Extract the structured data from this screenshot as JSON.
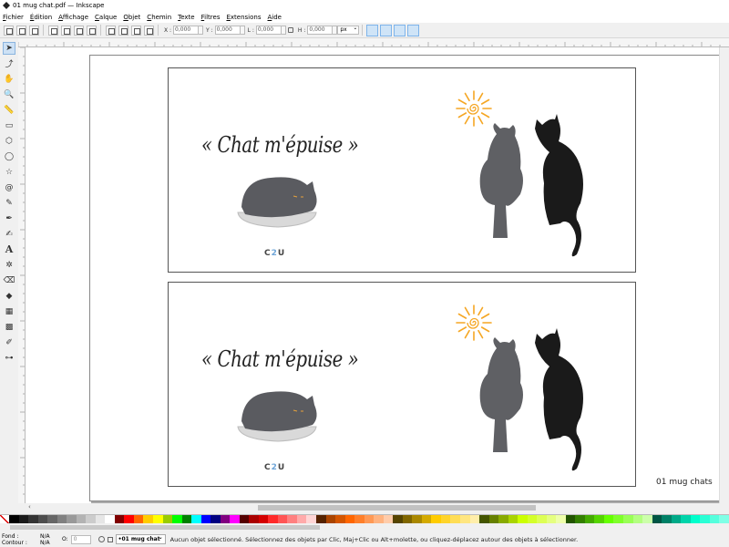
{
  "window": {
    "title": "01 mug chat.pdf — Inkscape"
  },
  "menu": [
    "Fichier",
    "Édition",
    "Affichage",
    "Calque",
    "Objet",
    "Chemin",
    "Texte",
    "Filtres",
    "Extensions",
    "Aide"
  ],
  "toolbar": {
    "x": {
      "label": "X :",
      "value": "0,000"
    },
    "y": {
      "label": "Y :",
      "value": "0,000"
    },
    "w": {
      "label": "L :",
      "value": "0,000"
    },
    "h": {
      "label": "H :",
      "value": "0,000"
    },
    "unit": "px"
  },
  "tools": [
    {
      "name": "selector-tool",
      "glyph": "➤"
    },
    {
      "name": "node-tool",
      "glyph": "⤴"
    },
    {
      "name": "tweak-tool",
      "glyph": "✋"
    },
    {
      "name": "zoom-tool",
      "glyph": "🔍"
    },
    {
      "name": "measure-tool",
      "glyph": "📏"
    },
    {
      "name": "rect-tool",
      "glyph": "▭"
    },
    {
      "name": "3dbox-tool",
      "glyph": "⬡"
    },
    {
      "name": "ellipse-tool",
      "glyph": "◯"
    },
    {
      "name": "star-tool",
      "glyph": "☆"
    },
    {
      "name": "spiral-tool",
      "glyph": "@"
    },
    {
      "name": "pencil-tool",
      "glyph": "✎"
    },
    {
      "name": "pen-tool",
      "glyph": "✒"
    },
    {
      "name": "calligraphy-tool",
      "glyph": "✍"
    },
    {
      "name": "text-tool",
      "glyph": "A"
    },
    {
      "name": "spray-tool",
      "glyph": "✲"
    },
    {
      "name": "eraser-tool",
      "glyph": "⌫"
    },
    {
      "name": "bucket-tool",
      "glyph": "◆"
    },
    {
      "name": "gradient-tool",
      "glyph": "▦"
    },
    {
      "name": "mesh-tool",
      "glyph": "▩"
    },
    {
      "name": "dropper-tool",
      "glyph": "✐"
    },
    {
      "name": "connector-tool",
      "glyph": "⊶"
    }
  ],
  "canvas": {
    "slogan": "« Chat m'épuise »",
    "logo_a": "C",
    "logo_b": "2",
    "logo_c": "U",
    "caption": "01 mug chats"
  },
  "colors": {
    "sun": "#f5a623",
    "grey_cat": "#5f6064",
    "black_cat": "#1a1a1a",
    "bowl": "#d9d9d9",
    "sleeping_cat": "#5a5b60"
  },
  "palette": [
    "#000000",
    "#1a1a1a",
    "#333333",
    "#4d4d4d",
    "#666666",
    "#808080",
    "#999999",
    "#b3b3b3",
    "#cccccc",
    "#e6e6e6",
    "#ffffff",
    "#800000",
    "#ff0000",
    "#ff6600",
    "#ffcc00",
    "#ffff00",
    "#99cc00",
    "#00ff00",
    "#008000",
    "#00ffff",
    "#0000ff",
    "#000080",
    "#800080",
    "#ff00ff",
    "#550000",
    "#aa0000",
    "#d40000",
    "#ff2a2a",
    "#ff5555",
    "#ff8080",
    "#ffaaaa",
    "#ffd5d5",
    "#552200",
    "#aa4400",
    "#d45500",
    "#ff6600",
    "#ff7f2a",
    "#ff9955",
    "#ffb380",
    "#ffccaa",
    "#554400",
    "#806600",
    "#aa8800",
    "#d4aa00",
    "#ffcc00",
    "#ffd42a",
    "#ffdd55",
    "#ffe680",
    "#ffeeaa",
    "#445500",
    "#668000",
    "#88aa00",
    "#aad400",
    "#ccff00",
    "#d4ff2a",
    "#ddff55",
    "#e5ff80",
    "#eeffaa",
    "#225500",
    "#338000",
    "#44aa00",
    "#55d400",
    "#66ff00",
    "#7fff2a",
    "#99ff55",
    "#b3ff80",
    "#ccffaa",
    "#005544",
    "#008066",
    "#00aa88",
    "#00d4aa",
    "#00ffcc",
    "#2affd5",
    "#55ffdd",
    "#80ffe6"
  ],
  "status": {
    "fill_label": "Fond :",
    "fill_value": "N/A",
    "stroke_label": "Contour :",
    "stroke_value": "N/A",
    "opacity_label": "O:",
    "opacity_value": "0",
    "layer": "•01 mug chat",
    "message": "Aucun objet sélectionné. Sélectionnez des objets par Clic, Maj+Clic ou Alt+molette, ou cliquez-déplacez autour des objets à sélectionner."
  }
}
